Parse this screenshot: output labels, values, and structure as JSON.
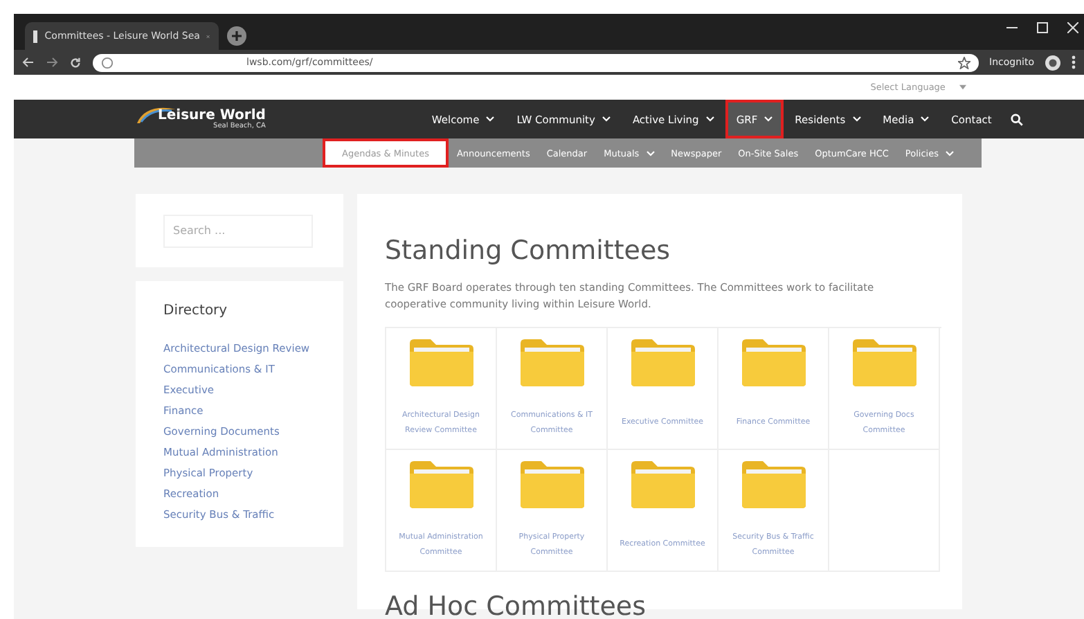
{
  "browser": {
    "tab_title": "Committees - Leisure World Sea",
    "url": "lwsb.com/grf/committees/",
    "incognito_label": "Incognito"
  },
  "language_selector": {
    "label": "Select Language"
  },
  "site": {
    "logo_title": "Leisure World",
    "logo_subtitle": "Seal Beach, CA"
  },
  "nav": [
    {
      "label": "Welcome",
      "dropdown": true,
      "selected": false,
      "highlighted": false
    },
    {
      "label": "LW Community",
      "dropdown": true,
      "selected": false,
      "highlighted": false
    },
    {
      "label": "Active Living",
      "dropdown": true,
      "selected": false,
      "highlighted": false
    },
    {
      "label": "GRF",
      "dropdown": true,
      "selected": true,
      "highlighted": true
    },
    {
      "label": "Residents",
      "dropdown": true,
      "selected": false,
      "highlighted": false
    },
    {
      "label": "Media",
      "dropdown": true,
      "selected": false,
      "highlighted": false
    },
    {
      "label": "Contact",
      "dropdown": false,
      "selected": false,
      "highlighted": false
    }
  ],
  "subnav": [
    {
      "label": "Agendas & Minutes",
      "dropdown": false,
      "selected": true,
      "highlighted": true
    },
    {
      "label": "Announcements",
      "dropdown": false,
      "selected": false,
      "highlighted": false
    },
    {
      "label": "Calendar",
      "dropdown": false,
      "selected": false,
      "highlighted": false
    },
    {
      "label": "Mutuals",
      "dropdown": true,
      "selected": false,
      "highlighted": false
    },
    {
      "label": "Newspaper",
      "dropdown": false,
      "selected": false,
      "highlighted": false
    },
    {
      "label": "On-Site Sales",
      "dropdown": false,
      "selected": false,
      "highlighted": false
    },
    {
      "label": "OptumCare HCC",
      "dropdown": false,
      "selected": false,
      "highlighted": false
    },
    {
      "label": "Policies",
      "dropdown": true,
      "selected": false,
      "highlighted": false
    }
  ],
  "sidebar": {
    "search_placeholder": "Search ...",
    "directory_title": "Directory",
    "links": [
      "Architectural Design Review",
      "Communications & IT",
      "Executive",
      "Finance",
      "Governing Documents",
      "Mutual Administration",
      "Physical Property",
      "Recreation",
      "Security Bus & Traffic"
    ]
  },
  "main": {
    "heading": "Standing Committees",
    "intro": "The GRF Board operates through ten standing Committees.  The Committees work to facilitate cooperative community living within Leisure World.",
    "committees": [
      "Architectural Design Review Committee",
      "Communications & IT Committee",
      "Executive Committee",
      "Finance Committee",
      "Governing Docs Committee",
      "Mutual Administration Committee",
      "Physical Property Committee",
      "Recreation Committee",
      "Security Bus & Traffic Committee"
    ],
    "second_heading": "Ad Hoc Committees"
  }
}
